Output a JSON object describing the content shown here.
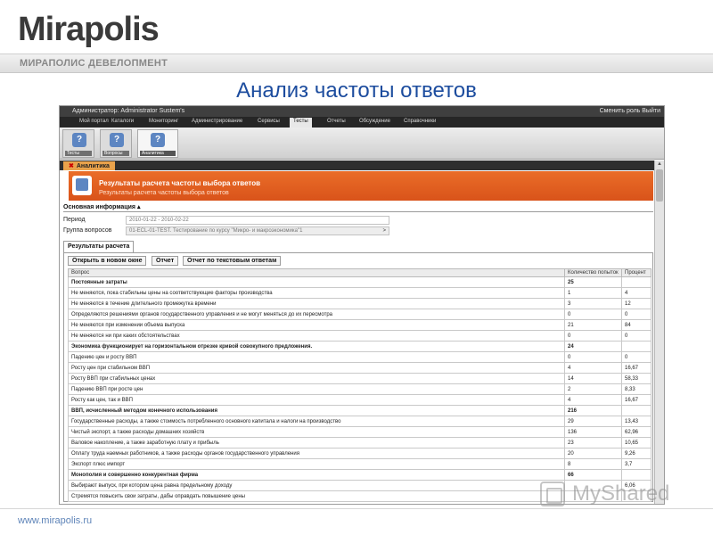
{
  "slide": {
    "logo": "Mirapolis",
    "banner": "МИРАПОЛИС ДЕВЕЛОПМЕНТ",
    "title": "Анализ частоты ответов",
    "footer_url": "www.mirapolis.ru",
    "watermark": "MyShared"
  },
  "app": {
    "admin": "Администратор: Administrator Sustem's",
    "change_role": "Сменить роль Выйти",
    "nav": [
      "Мой портал",
      "Каталоги",
      "Мониторинг",
      "Администрирование",
      "Сервисы",
      "Тесты",
      "Отчеты",
      "Обсуждение",
      "Справочники"
    ],
    "active_nav": "Тесты",
    "toolbar": [
      {
        "label": "Тесты",
        "icon": "tests-icon"
      },
      {
        "label": "Вопросы",
        "icon": "questions-icon"
      },
      {
        "label": "Аналитика",
        "icon": "analytics-icon"
      }
    ],
    "section_tab": "Аналитика",
    "panel_title": "Результаты расчета частоты выбора ответов",
    "panel_subtitle": "Результаты расчета частоты выбора ответов"
  },
  "info": {
    "heading": "Основная информация",
    "period_label": "Период",
    "period_value": "2010-01-22 - 2010-02-22",
    "group_label": "Группа вопросов",
    "group_value": "01-ECL-01-TEST. Тестирование по курсу \"Микро- и макроэкономика\"1",
    "group_arrow": ">"
  },
  "results": {
    "tab": "Результаты расчета",
    "buttons": [
      "Открыть в новом окне",
      "Отчет",
      "Отчет по текстовым ответам"
    ],
    "columns": [
      "Вопрос",
      "Количество попыток",
      "Процент"
    ],
    "rows": [
      {
        "q": "Постоянные затраты",
        "n": "25",
        "p": "",
        "section": true
      },
      {
        "q": "Не меняются, пока стабильны цены на соответствующие факторы производства",
        "n": "1",
        "p": "4",
        "section": false
      },
      {
        "q": "Не меняются в течение длительного промежутка времени",
        "n": "3",
        "p": "12",
        "section": false
      },
      {
        "q": "Определяются решениями органов государственного управления и не могут меняться до их пересмотра",
        "n": "0",
        "p": "0",
        "section": false
      },
      {
        "q": "Не меняются при изменении объема выпуска",
        "n": "21",
        "p": "84",
        "section": false
      },
      {
        "q": "Не меняются ни при каких обстоятельствах",
        "n": "0",
        "p": "0",
        "section": false
      },
      {
        "q": "Экономика функционирует на горизонтальном отрезке кривой совокупного предложения.",
        "n": "24",
        "p": "",
        "section": true
      },
      {
        "q": "Падению цен и росту ВВП",
        "n": "0",
        "p": "0",
        "section": false
      },
      {
        "q": "Росту цен при стабильном ВВП",
        "n": "4",
        "p": "16,67",
        "section": false
      },
      {
        "q": "Росту ВВП при стабильных ценах",
        "n": "14",
        "p": "58,33",
        "section": false
      },
      {
        "q": "Падению ВВП при росте цен",
        "n": "2",
        "p": "8,33",
        "section": false
      },
      {
        "q": "Росту как цен, так и ВВП",
        "n": "4",
        "p": "16,67",
        "section": false
      },
      {
        "q": "ВВП, исчисленный методом конечного использования",
        "n": "216",
        "p": "",
        "section": true
      },
      {
        "q": "Государственные расходы, а также стоимость потребленного основного капитала и налоги на производство",
        "n": "29",
        "p": "13,43",
        "section": false
      },
      {
        "q": "Чистый экспорт, а также расходы домашних хозяйств",
        "n": "136",
        "p": "62,96",
        "section": false
      },
      {
        "q": "Валовое накопление, а также заработную плату и прибыль",
        "n": "23",
        "p": "10,65",
        "section": false
      },
      {
        "q": "Оплату труда наемных работников, а также расходы органов государственного управления",
        "n": "20",
        "p": "9,26",
        "section": false
      },
      {
        "q": "Экспорт плюс импорт",
        "n": "8",
        "p": "3,7",
        "section": false
      },
      {
        "q": "Монополия и совершенно конкурентная фирма",
        "n": "66",
        "p": "",
        "section": true
      },
      {
        "q": "Выбирают выпуск, при котором цена равна предельному доходу",
        "n": "",
        "p": "6,06",
        "section": false
      },
      {
        "q": "Стремятся повысить свои затраты, дабы оправдать повышение цены",
        "n": "",
        "p": "",
        "section": false
      }
    ]
  }
}
